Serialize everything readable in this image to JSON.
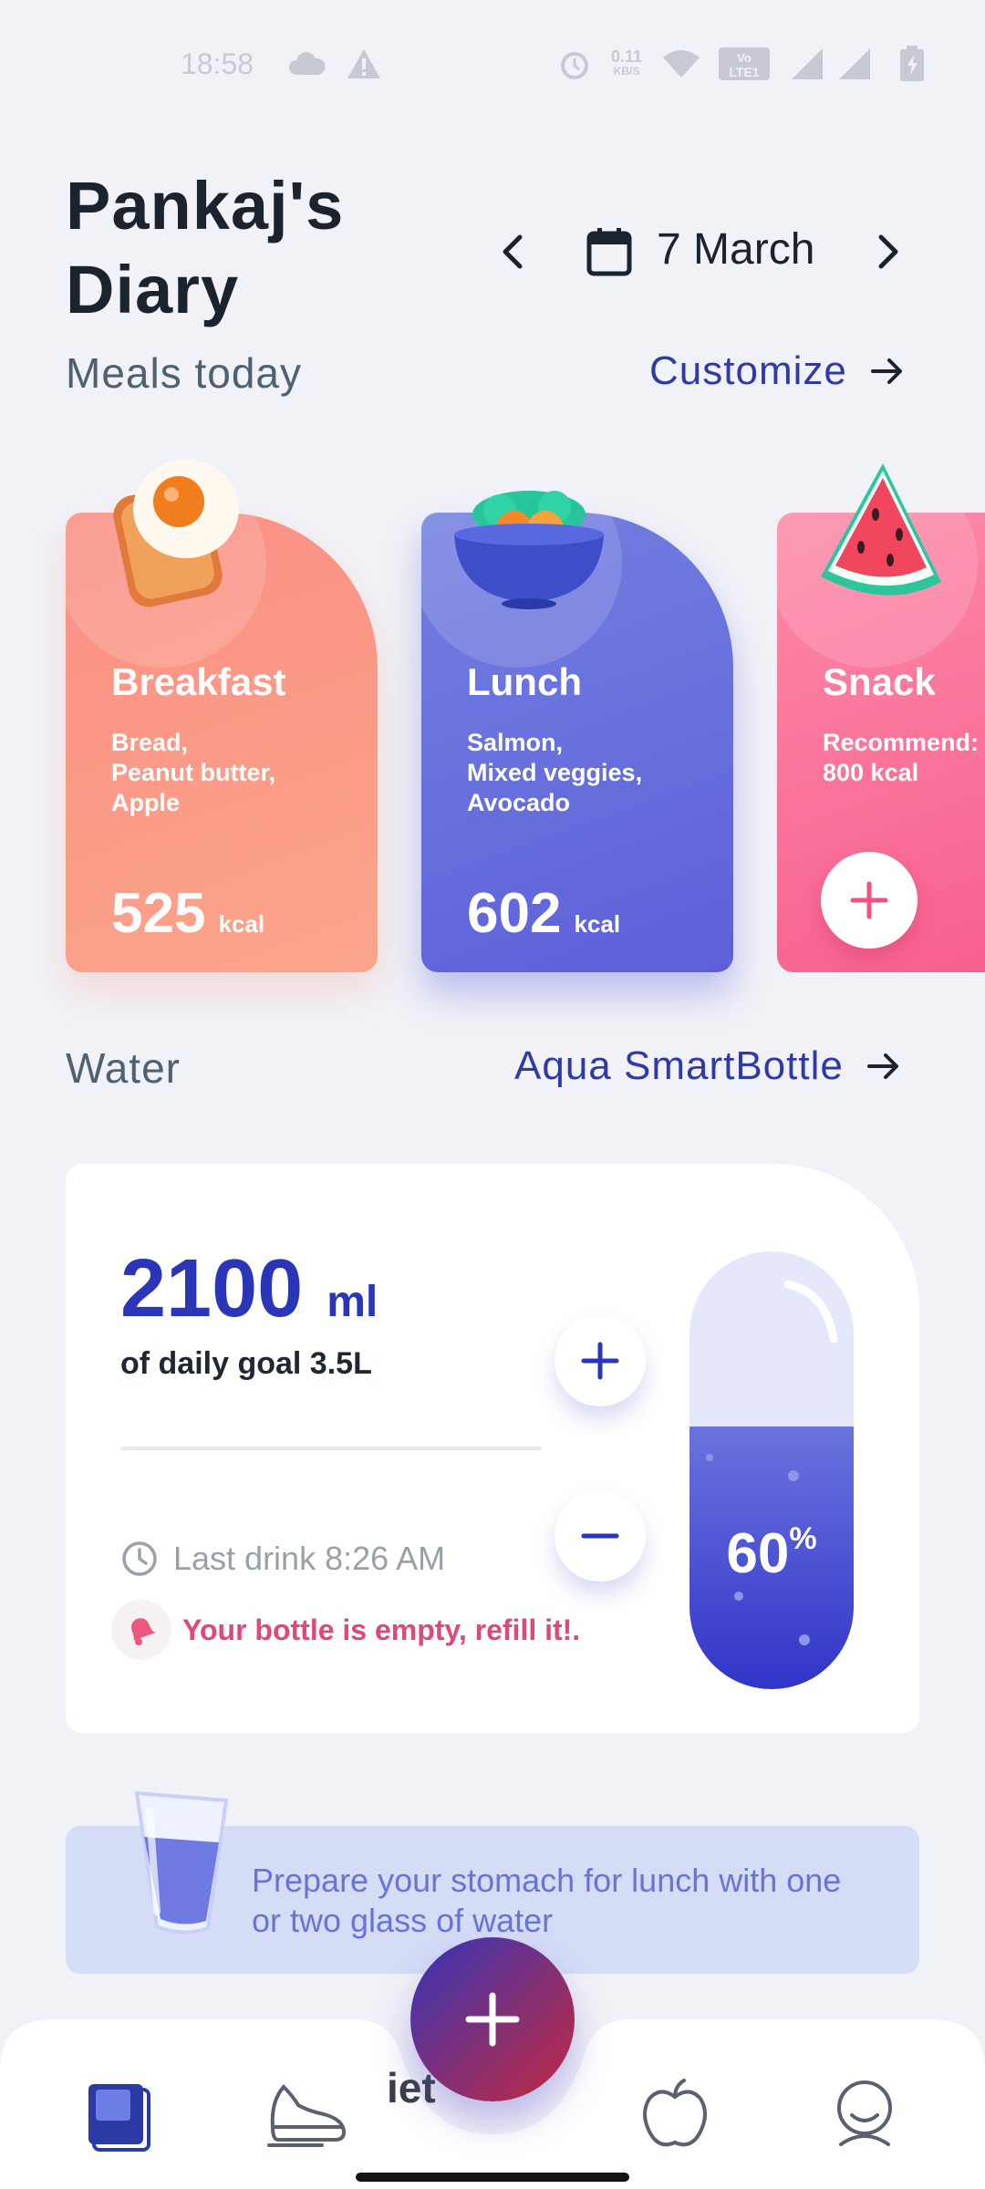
{
  "status_bar": {
    "time": "18:58",
    "network_speed": "0.11",
    "network_speed_unit": "KB/S",
    "icons": [
      "cloud-icon",
      "warning-icon",
      "alarm-icon",
      "wifi-icon",
      "volte-icon",
      "signal-icon",
      "signal-icon",
      "battery-icon"
    ]
  },
  "header": {
    "title": "Pankaj's Diary",
    "date": "7 March",
    "prev_icon": "chevron-left-icon",
    "next_icon": "chevron-right-icon",
    "calendar_icon": "calendar-icon"
  },
  "meals": {
    "section_title": "Meals today",
    "link_label": "Customize",
    "cards": [
      {
        "name": "Breakfast",
        "items": "Bread,\nPeanut butter,\nApple",
        "kcal": "525",
        "unit": "kcal",
        "icon": "toast-egg-icon",
        "color": "#fa8f84"
      },
      {
        "name": "Lunch",
        "items": "Salmon,\nMixed veggies,\nAvocado",
        "kcal": "602",
        "unit": "kcal",
        "icon": "salad-bowl-icon",
        "color": "#6a70de"
      },
      {
        "name": "Snack",
        "items": "Recommend:\n800 kcal",
        "icon": "watermelon-icon",
        "add_icon": "plus-icon",
        "color": "#fa6f98"
      }
    ]
  },
  "water": {
    "section_title": "Water",
    "link_label": "Aqua SmartBottle",
    "amount": "2100",
    "unit": "ml",
    "goal_text": "of daily goal 3.5L",
    "last_drink": "Last drink 8:26 AM",
    "warning": "Your bottle is empty, refill it!.",
    "percent": "60",
    "percent_sign": "%",
    "fill_fraction": 0.6,
    "accent": "#2a35b7"
  },
  "tip": {
    "text": "Prepare your stomach for lunch with one or two glass of water",
    "icon": "water-glass-icon"
  },
  "nav": {
    "peek_text": "iet",
    "items": [
      "diary-icon",
      "activity-icon",
      "add-icon",
      "nutrition-apple-icon",
      "profile-icon"
    ]
  }
}
